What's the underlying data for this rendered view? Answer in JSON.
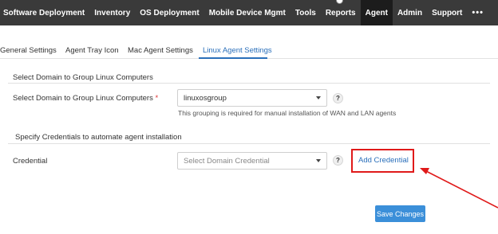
{
  "nav": {
    "items": [
      "Software Deployment",
      "Inventory",
      "OS Deployment",
      "Mobile Device Mgmt",
      "Tools",
      "Reports",
      "Agent",
      "Admin",
      "Support"
    ],
    "active_index": 6,
    "more": "•••"
  },
  "tabs": {
    "items": [
      "General Settings",
      "Agent Tray Icon",
      "Mac Agent Settings",
      "Linux Agent Settings"
    ],
    "active_index": 3
  },
  "domain_section": {
    "title": "Select Domain to Group Linux Computers",
    "label": "Select Domain to Group Linux Computers",
    "required_mark": "*",
    "value": "linuxosgroup",
    "hint": "This grouping is required for manual installation of WAN and LAN agents",
    "help": "?"
  },
  "credential_section": {
    "title": "Specify Credentials to automate agent installation",
    "label": "Credential",
    "placeholder": "Select Domain Credential",
    "help": "?",
    "add_link": "Add Credential"
  },
  "actions": {
    "save": "Save Changes"
  },
  "colors": {
    "nav_bg": "#3a3a3a",
    "nav_active": "#1c1c1c",
    "accent": "#2a6fba",
    "button": "#3b8fd9",
    "highlight": "#e01a1a"
  }
}
